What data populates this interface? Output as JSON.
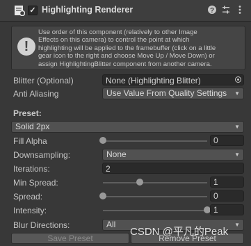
{
  "header": {
    "title": "Highlighting Renderer",
    "enabled_check": "✓",
    "help_icon": "question-icon",
    "preset_icon": "sliders-icon",
    "menu_icon": "kebab-menu-icon"
  },
  "help": {
    "icon": "exclamation-icon",
    "lines": [
      "Use order of this component (relatively to other Image",
      "Effects on this camera) to control the point at which",
      "highlighting will be applied to the framebuffer (click on a little",
      "gear icon to the right and choose Move Up / Move Down) or",
      "assign HighlightingBlitter component from another camera."
    ]
  },
  "fields": {
    "blitter": {
      "label": "Blitter (Optional)",
      "value": "None (Highlighting Blitter)"
    },
    "anti_aliasing": {
      "label": "Anti Aliasing",
      "value": "Use Value From Quality Settings"
    }
  },
  "preset": {
    "section_label": "Preset:",
    "value": "Solid 2px"
  },
  "settings": {
    "fill_alpha": {
      "label": "Fill Alpha",
      "value": "0",
      "level": 0.0
    },
    "downsampling": {
      "label": "Downsampling:",
      "value": "None"
    },
    "iterations": {
      "label": "Iterations:",
      "value": "2"
    },
    "min_spread": {
      "label": "Min Spread:",
      "value": "1",
      "level": 0.35
    },
    "spread": {
      "label": "Spread:",
      "value": "0",
      "level": 0.0
    },
    "intensity": {
      "label": "Intensity:",
      "value": "1",
      "level": 1.0
    },
    "blur_directions": {
      "label": "Blur Directions:",
      "value": "All"
    }
  },
  "buttons": {
    "save_preset": "Save Preset",
    "remove_preset": "Remove Preset"
  },
  "watermark": "CSDN @平凡的Peak",
  "colors": {
    "background": "#383838",
    "field": "#2a2a2a",
    "dropdown": "#515151",
    "slider_thumb": "#999999"
  }
}
